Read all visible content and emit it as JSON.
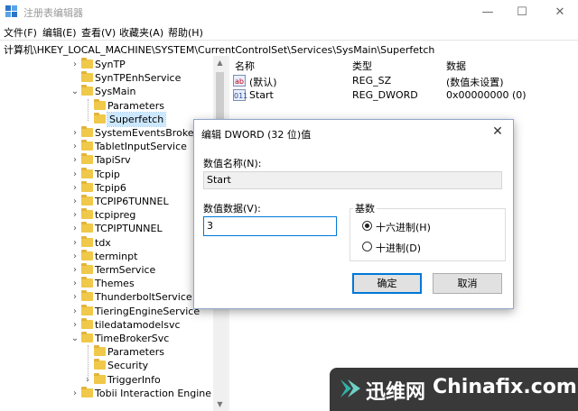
{
  "window": {
    "title": "注册表编辑器",
    "buttons": {
      "minimize": "—",
      "maximize": "☐",
      "close": "✕"
    }
  },
  "menu": [
    "文件(F)",
    "编辑(E)",
    "查看(V)",
    "收藏夹(A)",
    "帮助(H)"
  ],
  "address": "计算机\\HKEY_LOCAL_MACHINE\\SYSTEM\\CurrentControlSet\\Services\\SysMain\\Superfetch",
  "tree": [
    {
      "label": "SynTP",
      "expander": "›",
      "level": 0
    },
    {
      "label": "SynTPEnhService",
      "expander": "",
      "level": 0
    },
    {
      "label": "SysMain",
      "expander": "⌄",
      "level": 0
    },
    {
      "label": "Parameters",
      "expander": "",
      "level": 1
    },
    {
      "label": "Superfetch",
      "expander": "",
      "level": 1,
      "selected": true
    },
    {
      "label": "SystemEventsBroker",
      "expander": "›",
      "level": 0
    },
    {
      "label": "TabletInputService",
      "expander": "›",
      "level": 0
    },
    {
      "label": "TapiSrv",
      "expander": "›",
      "level": 0
    },
    {
      "label": "Tcpip",
      "expander": "›",
      "level": 0
    },
    {
      "label": "Tcpip6",
      "expander": "›",
      "level": 0
    },
    {
      "label": "TCPIP6TUNNEL",
      "expander": "›",
      "level": 0
    },
    {
      "label": "tcpipreg",
      "expander": "›",
      "level": 0
    },
    {
      "label": "TCPIPTUNNEL",
      "expander": "›",
      "level": 0
    },
    {
      "label": "tdx",
      "expander": "›",
      "level": 0
    },
    {
      "label": "terminpt",
      "expander": "›",
      "level": 0
    },
    {
      "label": "TermService",
      "expander": "›",
      "level": 0
    },
    {
      "label": "Themes",
      "expander": "›",
      "level": 0
    },
    {
      "label": "ThunderboltService",
      "expander": "›",
      "level": 0
    },
    {
      "label": "TieringEngineService",
      "expander": "›",
      "level": 0
    },
    {
      "label": "tiledatamodelsvc",
      "expander": "›",
      "level": 0
    },
    {
      "label": "TimeBrokerSvc",
      "expander": "⌄",
      "level": 0
    },
    {
      "label": "Parameters",
      "expander": "",
      "level": 1
    },
    {
      "label": "Security",
      "expander": "",
      "level": 1
    },
    {
      "label": "TriggerInfo",
      "expander": "›",
      "level": 1
    },
    {
      "label": "Tobii Interaction Engine",
      "expander": "›",
      "level": 0
    }
  ],
  "list": {
    "headers": {
      "name": "名称",
      "type": "类型",
      "data": "数据"
    },
    "rows": [
      {
        "icon": "ab",
        "name": "(默认)",
        "type": "REG_SZ",
        "data": "(数值未设置)"
      },
      {
        "icon": "011",
        "name": "Start",
        "type": "REG_DWORD",
        "data": "0x00000000 (0)"
      }
    ]
  },
  "dialog": {
    "title": "编辑 DWORD (32 位)值",
    "close": "✕",
    "name_label": "数值名称(N):",
    "name_value": "Start",
    "data_label": "数值数据(V):",
    "data_value": "3",
    "base_label": "基数",
    "hex_label": "十六进制(H)",
    "dec_label": "十进制(D)",
    "selected_base": "hex",
    "ok": "确定",
    "cancel": "取消"
  },
  "watermark": {
    "brand_cn": "迅维网",
    "brand_en": "Chinafix.com"
  },
  "colors": {
    "accent": "#0078d7",
    "selection": "#cce8ff",
    "folder": "#f0c84a"
  }
}
